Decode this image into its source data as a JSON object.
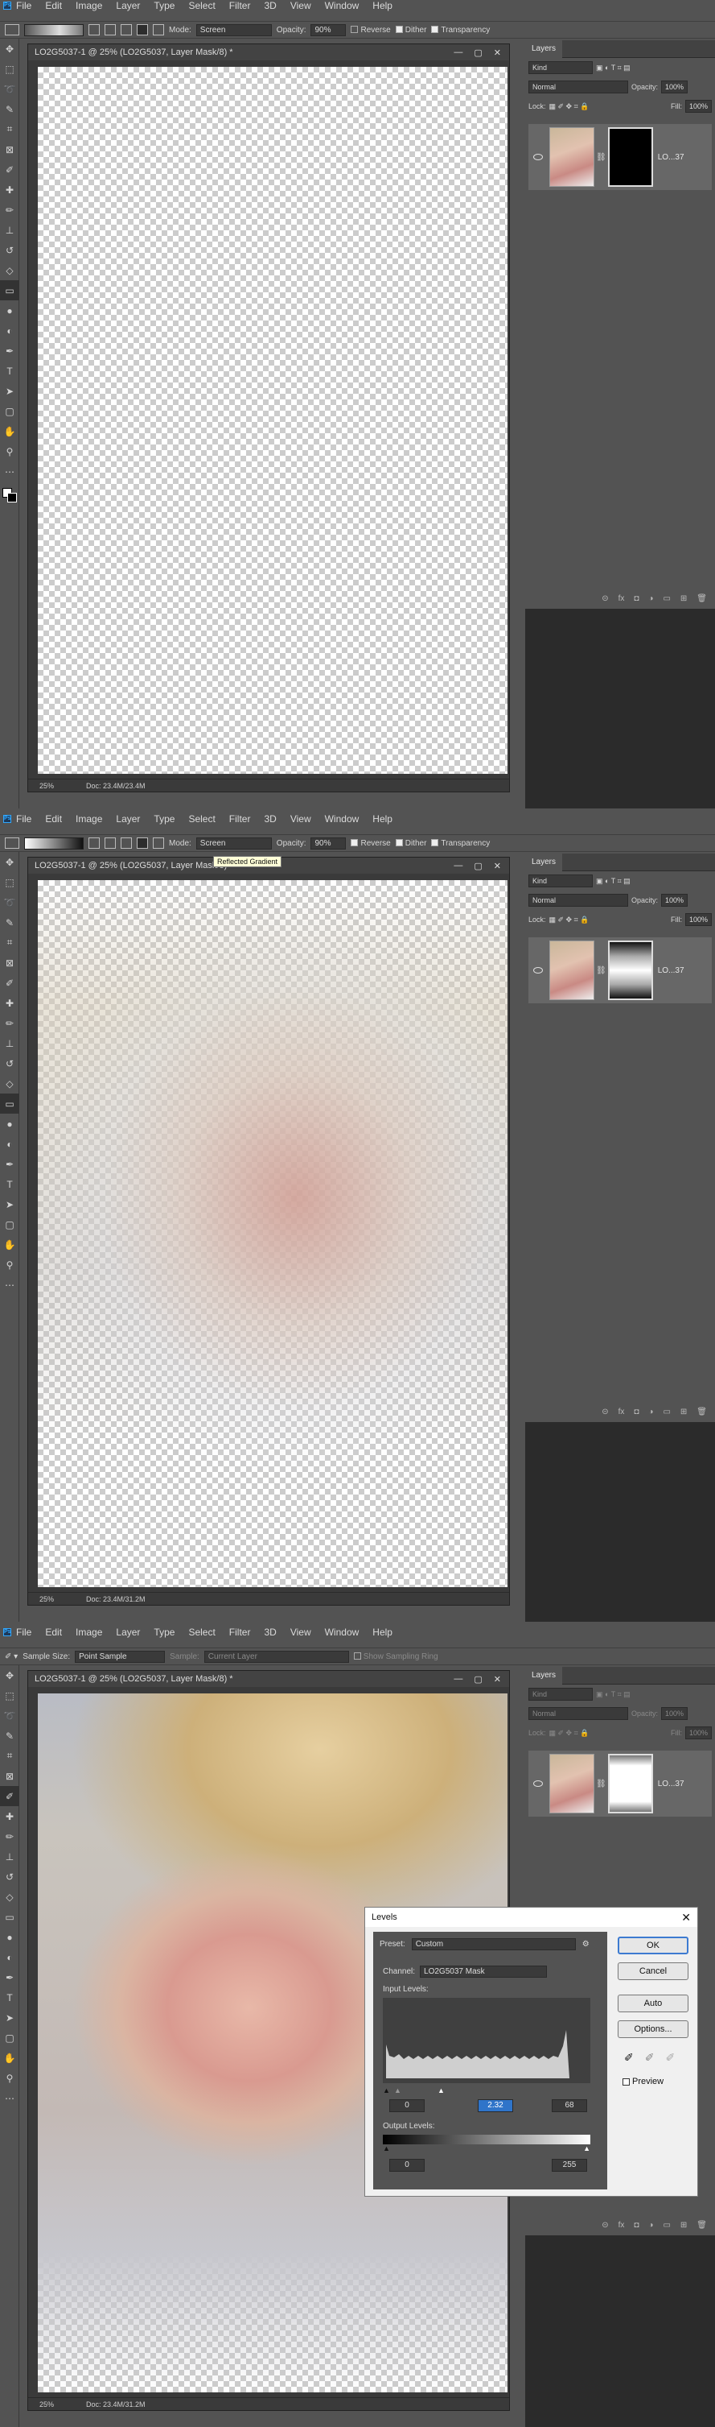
{
  "menu": [
    "File",
    "Edit",
    "Image",
    "Layer",
    "Type",
    "Select",
    "Filter",
    "3D",
    "View",
    "Window",
    "Help"
  ],
  "app_logo": "Ps",
  "gradient_options": {
    "mode_label": "Mode:",
    "mode_value": "Screen",
    "opacity_label": "Opacity:",
    "opacity_value": "90%",
    "reverse": "Reverse",
    "dither": "Dither",
    "transparency": "Transparency"
  },
  "eyedropper_options": {
    "sample_size_label": "Sample Size:",
    "sample_size_value": "Point Sample",
    "sample_label": "Sample:",
    "sample_value": "Current Layer",
    "show_ring": "Show Sampling Ring"
  },
  "tooltip": "Reflected Gradient",
  "document": {
    "title": "LO2G5037-1 @ 25% (LO2G5037, Layer Mask/8) *",
    "zoom": "25%",
    "doc_size_1": "Doc: 23.4M/23.4M",
    "doc_size_2": "Doc: 23.4M/31.2M",
    "doc_size_3": "Doc: 23.4M/31.2M"
  },
  "layers_panel": {
    "tab": "Layers",
    "kind": "Kind",
    "blend": "Normal",
    "opacity_label": "Opacity:",
    "opacity_value": "100%",
    "lock_label": "Lock:",
    "fill_label": "Fill:",
    "fill_value": "100%",
    "layer_name": "LO...37"
  },
  "levels": {
    "title": "Levels",
    "preset_label": "Preset:",
    "preset_value": "Custom",
    "channel_label": "Channel:",
    "channel_value": "LO2G5037 Mask",
    "input_levels_label": "Input Levels:",
    "input_black": "0",
    "input_gamma": "2.32",
    "input_white": "68",
    "output_levels_label": "Output Levels:",
    "output_black": "0",
    "output_white": "255",
    "ok": "OK",
    "cancel": "Cancel",
    "auto": "Auto",
    "options": "Options...",
    "preview": "Preview"
  },
  "colors": {
    "ps_blue": "#31a8ff",
    "ui_gray": "#535353",
    "highlight": "#2f74c9"
  },
  "icons": [
    "move-icon",
    "marquee-icon",
    "lasso-icon",
    "quick-select-icon",
    "crop-icon",
    "frame-icon",
    "eyedropper-icon",
    "healing-icon",
    "brush-icon",
    "stamp-icon",
    "history-brush-icon",
    "eraser-icon",
    "gradient-icon",
    "blur-icon",
    "dodge-icon",
    "pen-icon",
    "type-icon",
    "path-select-icon",
    "shape-icon",
    "hand-icon",
    "zoom-icon",
    "more-icon"
  ]
}
